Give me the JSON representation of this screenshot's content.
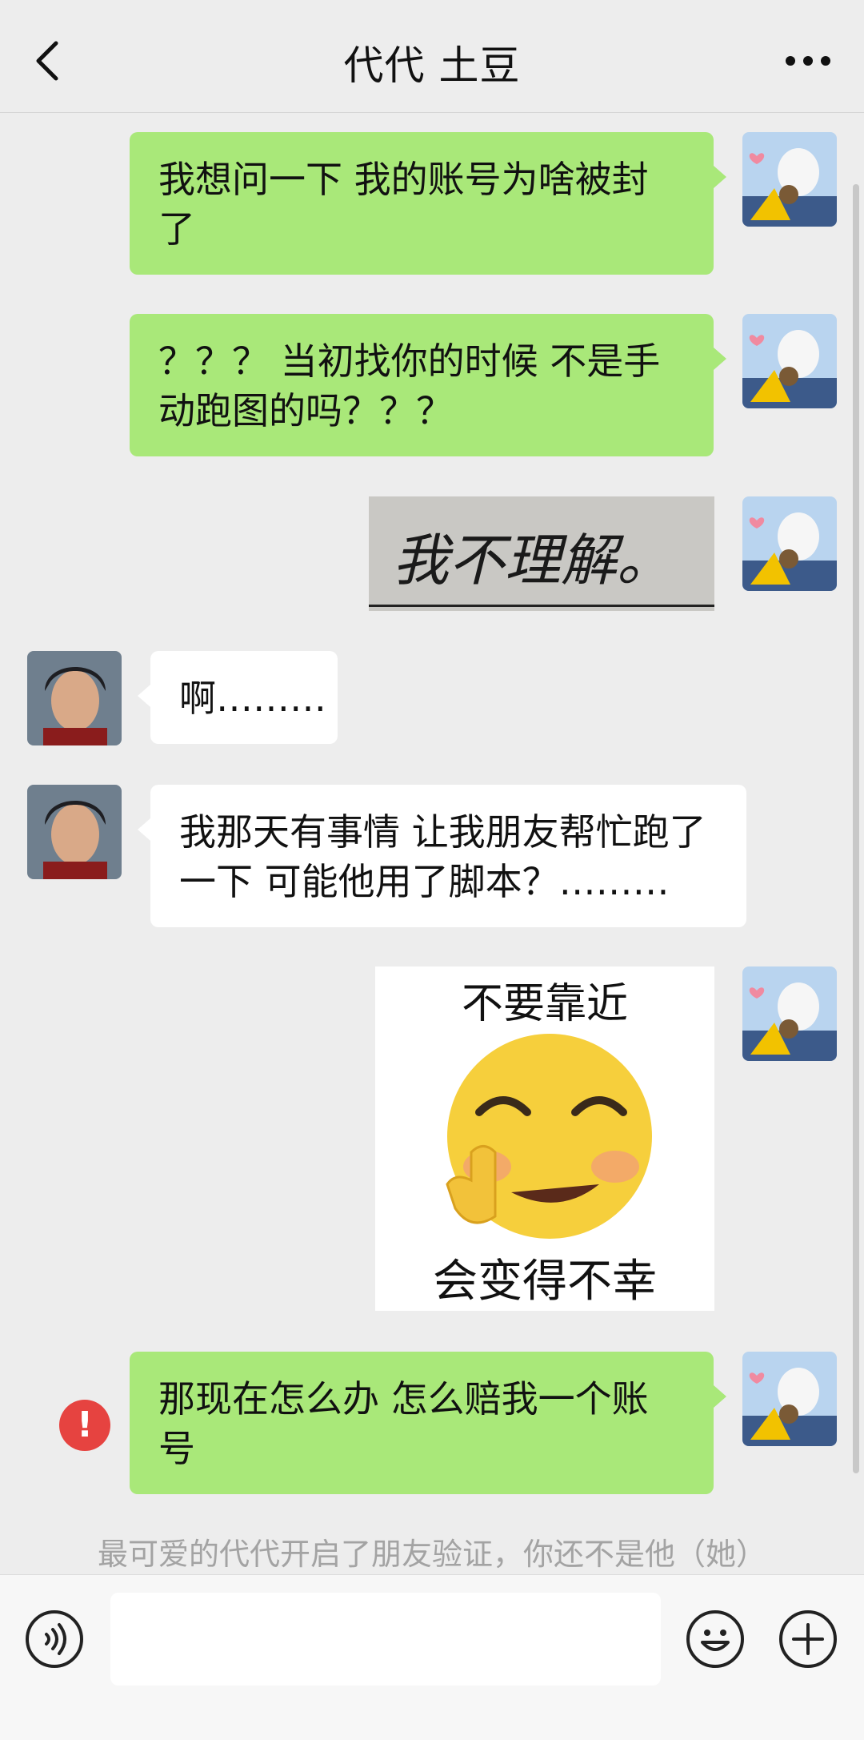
{
  "header": {
    "title": "代代 土豆",
    "back_icon": "chevron-left-icon",
    "more_icon": "more-dots-icon"
  },
  "messages": [
    {
      "from": "me",
      "type": "text",
      "text": "我想问一下 我的账号为啥被封了"
    },
    {
      "from": "me",
      "type": "text",
      "text": "？？？ 当初找你的时候 不是手动跑图的吗？？？"
    },
    {
      "from": "me",
      "type": "sticker",
      "text": "我不理解。"
    },
    {
      "from": "them",
      "type": "text",
      "text": "啊………"
    },
    {
      "from": "them",
      "type": "text",
      "text": "我那天有事情 让我朋友帮忙跑了一下 可能他用了脚本？………"
    },
    {
      "from": "me",
      "type": "sticker",
      "top_text": "不要靠近",
      "bottom_text": "会变得不幸"
    },
    {
      "from": "me",
      "type": "text",
      "text": "那现在怎么办 怎么赔我一个账号",
      "status": "failed"
    }
  ],
  "error_mark": "!",
  "system_note": "最可爱的代代开启了朋友验证，你还不是他（她）",
  "input_bar": {
    "voice_icon": "voice-icon",
    "emoji_icon": "emoji-icon",
    "plus_icon": "plus-icon"
  },
  "colors": {
    "my_bubble": "#a9e879",
    "their_bubble": "#ffffff",
    "background": "#ededed",
    "error": "#e64340"
  }
}
